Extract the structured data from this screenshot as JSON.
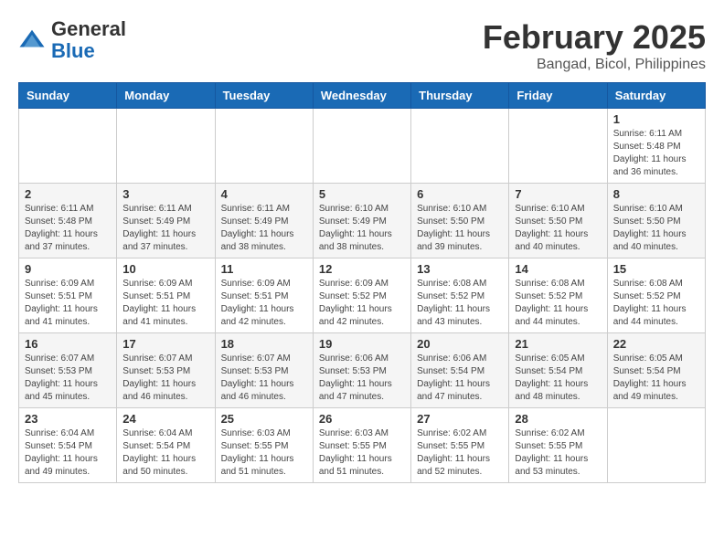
{
  "logo": {
    "general": "General",
    "blue": "Blue"
  },
  "title": "February 2025",
  "location": "Bangad, Bicol, Philippines",
  "weekdays": [
    "Sunday",
    "Monday",
    "Tuesday",
    "Wednesday",
    "Thursday",
    "Friday",
    "Saturday"
  ],
  "weeks": [
    [
      {
        "day": "",
        "info": ""
      },
      {
        "day": "",
        "info": ""
      },
      {
        "day": "",
        "info": ""
      },
      {
        "day": "",
        "info": ""
      },
      {
        "day": "",
        "info": ""
      },
      {
        "day": "",
        "info": ""
      },
      {
        "day": "1",
        "info": "Sunrise: 6:11 AM\nSunset: 5:48 PM\nDaylight: 11 hours\nand 36 minutes."
      }
    ],
    [
      {
        "day": "2",
        "info": "Sunrise: 6:11 AM\nSunset: 5:48 PM\nDaylight: 11 hours\nand 37 minutes."
      },
      {
        "day": "3",
        "info": "Sunrise: 6:11 AM\nSunset: 5:49 PM\nDaylight: 11 hours\nand 37 minutes."
      },
      {
        "day": "4",
        "info": "Sunrise: 6:11 AM\nSunset: 5:49 PM\nDaylight: 11 hours\nand 38 minutes."
      },
      {
        "day": "5",
        "info": "Sunrise: 6:10 AM\nSunset: 5:49 PM\nDaylight: 11 hours\nand 38 minutes."
      },
      {
        "day": "6",
        "info": "Sunrise: 6:10 AM\nSunset: 5:50 PM\nDaylight: 11 hours\nand 39 minutes."
      },
      {
        "day": "7",
        "info": "Sunrise: 6:10 AM\nSunset: 5:50 PM\nDaylight: 11 hours\nand 40 minutes."
      },
      {
        "day": "8",
        "info": "Sunrise: 6:10 AM\nSunset: 5:50 PM\nDaylight: 11 hours\nand 40 minutes."
      }
    ],
    [
      {
        "day": "9",
        "info": "Sunrise: 6:09 AM\nSunset: 5:51 PM\nDaylight: 11 hours\nand 41 minutes."
      },
      {
        "day": "10",
        "info": "Sunrise: 6:09 AM\nSunset: 5:51 PM\nDaylight: 11 hours\nand 41 minutes."
      },
      {
        "day": "11",
        "info": "Sunrise: 6:09 AM\nSunset: 5:51 PM\nDaylight: 11 hours\nand 42 minutes."
      },
      {
        "day": "12",
        "info": "Sunrise: 6:09 AM\nSunset: 5:52 PM\nDaylight: 11 hours\nand 42 minutes."
      },
      {
        "day": "13",
        "info": "Sunrise: 6:08 AM\nSunset: 5:52 PM\nDaylight: 11 hours\nand 43 minutes."
      },
      {
        "day": "14",
        "info": "Sunrise: 6:08 AM\nSunset: 5:52 PM\nDaylight: 11 hours\nand 44 minutes."
      },
      {
        "day": "15",
        "info": "Sunrise: 6:08 AM\nSunset: 5:52 PM\nDaylight: 11 hours\nand 44 minutes."
      }
    ],
    [
      {
        "day": "16",
        "info": "Sunrise: 6:07 AM\nSunset: 5:53 PM\nDaylight: 11 hours\nand 45 minutes."
      },
      {
        "day": "17",
        "info": "Sunrise: 6:07 AM\nSunset: 5:53 PM\nDaylight: 11 hours\nand 46 minutes."
      },
      {
        "day": "18",
        "info": "Sunrise: 6:07 AM\nSunset: 5:53 PM\nDaylight: 11 hours\nand 46 minutes."
      },
      {
        "day": "19",
        "info": "Sunrise: 6:06 AM\nSunset: 5:53 PM\nDaylight: 11 hours\nand 47 minutes."
      },
      {
        "day": "20",
        "info": "Sunrise: 6:06 AM\nSunset: 5:54 PM\nDaylight: 11 hours\nand 47 minutes."
      },
      {
        "day": "21",
        "info": "Sunrise: 6:05 AM\nSunset: 5:54 PM\nDaylight: 11 hours\nand 48 minutes."
      },
      {
        "day": "22",
        "info": "Sunrise: 6:05 AM\nSunset: 5:54 PM\nDaylight: 11 hours\nand 49 minutes."
      }
    ],
    [
      {
        "day": "23",
        "info": "Sunrise: 6:04 AM\nSunset: 5:54 PM\nDaylight: 11 hours\nand 49 minutes."
      },
      {
        "day": "24",
        "info": "Sunrise: 6:04 AM\nSunset: 5:54 PM\nDaylight: 11 hours\nand 50 minutes."
      },
      {
        "day": "25",
        "info": "Sunrise: 6:03 AM\nSunset: 5:55 PM\nDaylight: 11 hours\nand 51 minutes."
      },
      {
        "day": "26",
        "info": "Sunrise: 6:03 AM\nSunset: 5:55 PM\nDaylight: 11 hours\nand 51 minutes."
      },
      {
        "day": "27",
        "info": "Sunrise: 6:02 AM\nSunset: 5:55 PM\nDaylight: 11 hours\nand 52 minutes."
      },
      {
        "day": "28",
        "info": "Sunrise: 6:02 AM\nSunset: 5:55 PM\nDaylight: 11 hours\nand 53 minutes."
      },
      {
        "day": "",
        "info": ""
      }
    ]
  ]
}
